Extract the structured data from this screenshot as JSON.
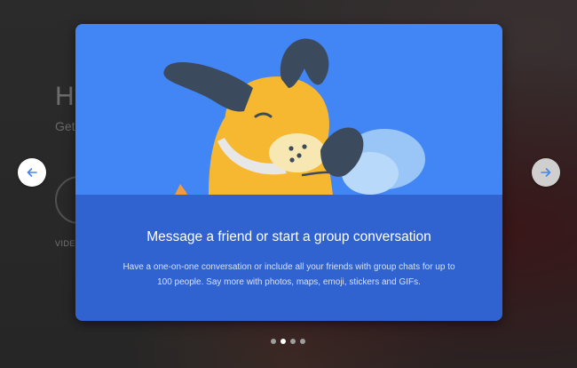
{
  "background": {
    "heading": "H",
    "subheading": "Get",
    "video_label": "VIDEO"
  },
  "carousel": {
    "prev_icon": "arrow-left-icon",
    "next_icon": "arrow-right-icon",
    "current_slide": 2,
    "total_slides": 4
  },
  "slide": {
    "title": "Message a friend or start a group conversation",
    "description": "Have a one-on-one conversation or include all your friends with group chats for up to 100 people. Say more with photos, maps, emoji, stickers and GIFs."
  },
  "colors": {
    "card_top": "#4285f4",
    "card_bottom": "#3062d0",
    "dog_body": "#f6b830",
    "dog_ears": "#3c4a5e"
  }
}
